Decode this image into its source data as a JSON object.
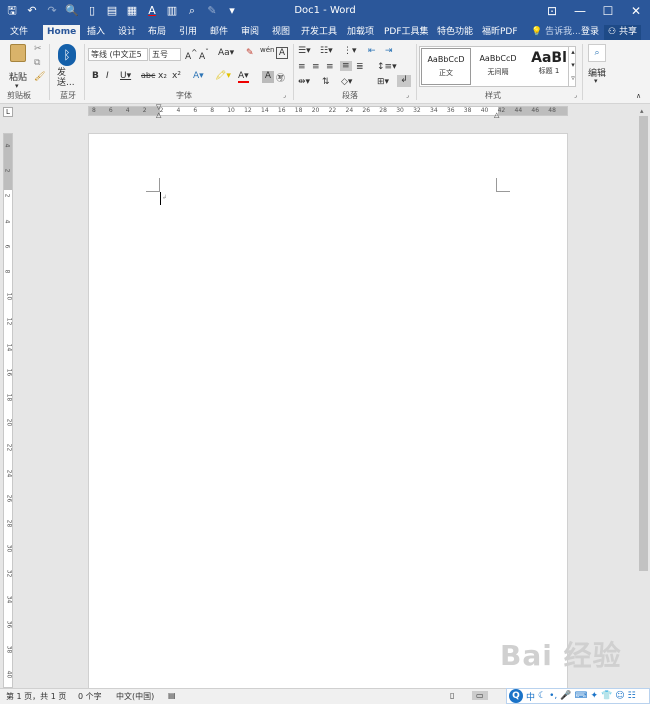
{
  "window": {
    "title": "Doc1 - Word",
    "controls": {
      "minimize": "—",
      "maximize": "☐",
      "close": "✕"
    }
  },
  "qat": [
    "save-icon",
    "undo-icon",
    "redo-icon",
    "print-preview-icon",
    "new-doc-icon",
    "paste-special-icon",
    "layout-icon",
    "font-color-icon",
    "columns-icon",
    "find-icon",
    "edit-icon",
    "customize-icon"
  ],
  "tabs": [
    "文件",
    "Home",
    "插入",
    "设计",
    "布局",
    "引用",
    "邮件",
    "审阅",
    "视图",
    "开发工具",
    "加载项",
    "PDF工具集",
    "特色功能",
    "福昕PDF"
  ],
  "tell_me": "告诉我...",
  "login": "登录",
  "share": "共享",
  "ribbon": {
    "clipboard": {
      "paste": "粘贴",
      "label": "剪贴板"
    },
    "bluetooth": {
      "send": "发送...",
      "label": "蓝牙"
    },
    "font": {
      "name": "等线 (中文正5",
      "size": "五号",
      "label": "字体"
    },
    "paragraph": {
      "label": "段落"
    },
    "styles": {
      "label": "样式",
      "items": [
        {
          "sample": "AaBbCcD",
          "name": "正文"
        },
        {
          "sample": "AaBbCcD",
          "name": "无间隔"
        },
        {
          "sample": "AaBl",
          "name": "标题 1"
        }
      ]
    },
    "editing": {
      "label": "编辑"
    }
  },
  "ruler": {
    "h_ticks": [
      "8",
      "6",
      "4",
      "2",
      "2",
      "4",
      "6",
      "8",
      "10",
      "12",
      "14",
      "16",
      "18",
      "20",
      "22",
      "24",
      "26",
      "28",
      "30",
      "32",
      "34",
      "36",
      "38",
      "40",
      "42",
      "44",
      "46",
      "48"
    ],
    "v_ticks": [
      "4",
      "2",
      "2",
      "4",
      "6",
      "8",
      "10",
      "12",
      "14",
      "16",
      "18",
      "20",
      "22",
      "24",
      "26",
      "28",
      "30",
      "32",
      "34",
      "36",
      "38",
      "40"
    ]
  },
  "status": {
    "page": "第 1 页，共 1 页",
    "words": "0 个字",
    "lang": "中文(中国)"
  },
  "ime": {
    "label": "中"
  },
  "watermark": "Bai 经验"
}
